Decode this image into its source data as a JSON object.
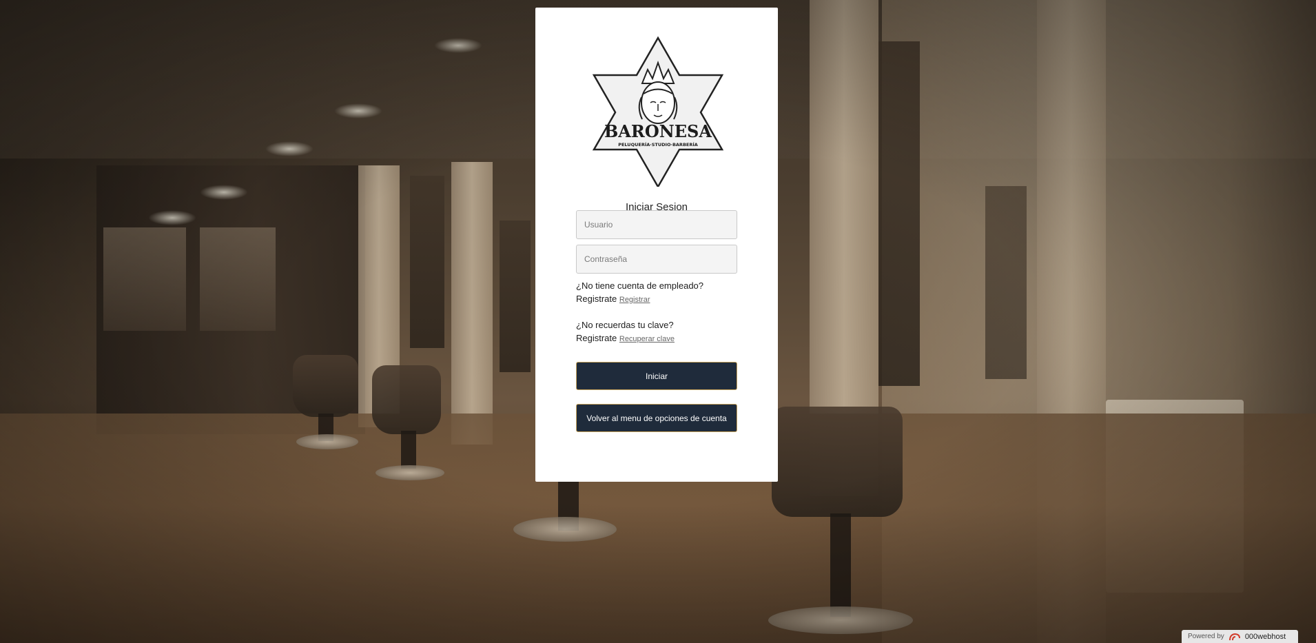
{
  "login": {
    "title": "Iniciar Sesion",
    "username_placeholder": "Usuario",
    "password_placeholder": "Contraseña",
    "no_account_question": "¿No tiene cuenta de empleado?",
    "register_prefix": "Registrate",
    "register_link": "Registrar",
    "forgot_question": "¿No recuerdas tu clave?",
    "recover_prefix": "Registrate",
    "recover_link": "Recuperar clave",
    "submit_label": "Iniciar",
    "back_label": "Volver al menu de opciones de cuenta"
  },
  "badge": {
    "powered_by": "Powered by",
    "host": "000webhost"
  },
  "logo": {
    "name": "BARONESA",
    "tagline": "PELUQUERÍA·STUDIO·BARBERÍA"
  },
  "colors": {
    "button_bg": "#1f2b3b",
    "button_border": "#c9a45c",
    "card_bg": "#ffffff"
  }
}
